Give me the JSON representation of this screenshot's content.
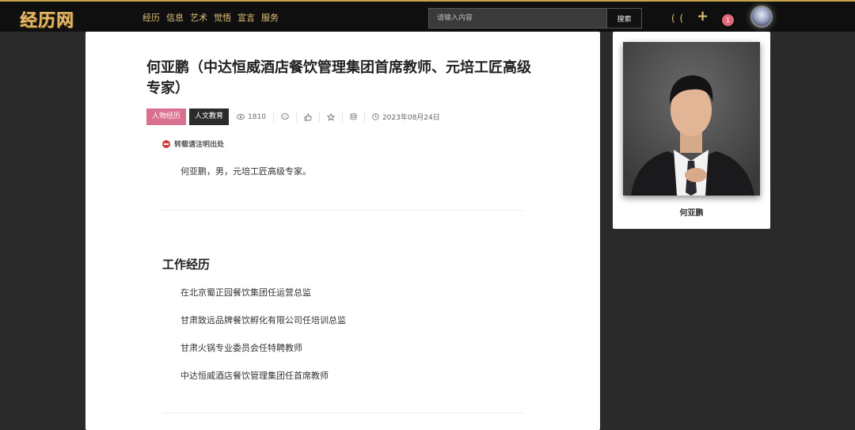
{
  "header": {
    "logo": "经历网",
    "nav": [
      "经历",
      "信息",
      "艺术",
      "觉悟",
      "宣言",
      "服务"
    ],
    "search_placeholder": "请输入内容",
    "search_button": "搜索",
    "paren_icon_text": "( (",
    "plus_icon_text": "+",
    "notification_count": "1"
  },
  "article": {
    "title": "何亚鹏（中达恒威酒店餐饮管理集团首席教师、元培工匠高级专家）",
    "tags": [
      "人物经历",
      "人文教育"
    ],
    "views": "1810",
    "date": "2023年08月24日",
    "notice": "转载请注明出处",
    "intro": "何亚鹏，男，元培工匠高级专家。",
    "section_title": "工作经历",
    "jobs": [
      "在北京蜀正园餐饮集团任运营总监",
      "甘肃致远品牌餐饮孵化有限公司任培训总监",
      "甘肃火锅专业委员会任特聘教师",
      "中达恒威酒店餐饮管理集团任首席教师"
    ]
  },
  "profile": {
    "name": "何亚鹏"
  },
  "colors": {
    "accent_gold": "#e0c27a",
    "tag_pink": "#d9708f",
    "tag_dark": "#2b2b2b",
    "badge": "#e06a7a"
  }
}
